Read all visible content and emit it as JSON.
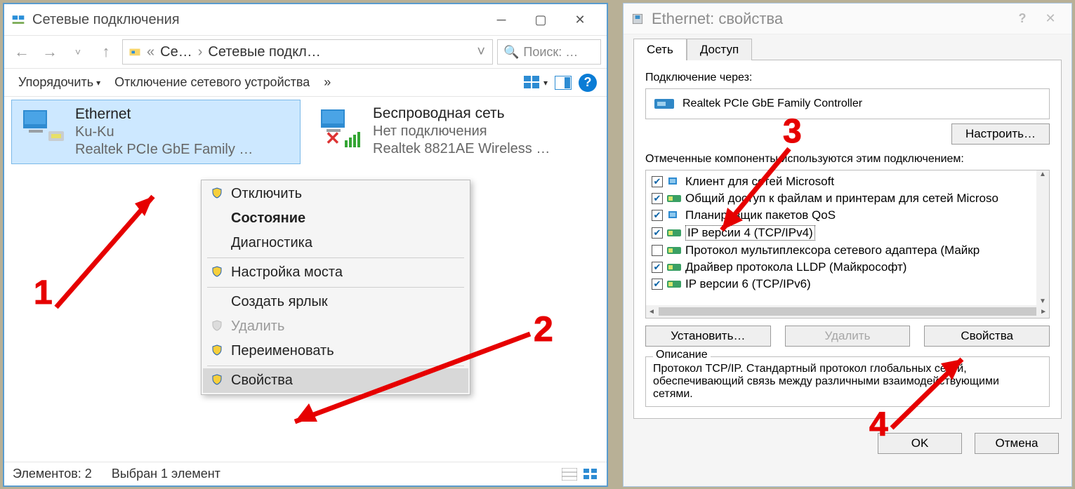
{
  "win1": {
    "title": "Сетевые подключения",
    "breadcrumb": {
      "seg1": "Се…",
      "seg2": "Сетевые подкл…"
    },
    "search_placeholder": "Поиск: …",
    "toolbar": {
      "organize": "Упорядочить",
      "disable": "Отключение сетевого устройства",
      "more": "»"
    },
    "connections": {
      "eth": {
        "name": "Ethernet",
        "sub1": "Ku-Ku",
        "sub2": "Realtek PCIe GbE Family …"
      },
      "wifi": {
        "name": "Беспроводная сеть",
        "sub1": "Нет подключения",
        "sub2": "Realtek 8821AE Wireless …"
      }
    },
    "ctx": {
      "disable": "Отключить",
      "status": "Состояние",
      "diagnose": "Диагностика",
      "bridge": "Настройка моста",
      "shortcut": "Создать ярлык",
      "delete": "Удалить",
      "rename": "Переименовать",
      "properties": "Свойства"
    },
    "status": {
      "elements": "Элементов: 2",
      "selected": "Выбран 1 элемент"
    }
  },
  "win2": {
    "title": "Ethernet: свойства",
    "tabs": {
      "net": "Сеть",
      "access": "Доступ"
    },
    "connect_via_label": "Подключение через:",
    "adapter": "Realtek PCIe GbE Family Controller",
    "configure": "Настроить…",
    "components_label": "Отмеченные компоненты используются этим подключением:",
    "components": [
      {
        "checked": true,
        "text": "Клиент для сетей Microsoft"
      },
      {
        "checked": true,
        "text": "Общий доступ к файлам и принтерам для сетей Microso"
      },
      {
        "checked": true,
        "text": "Планировщик пакетов QoS"
      },
      {
        "checked": true,
        "text": "IP версии 4 (TCP/IPv4)",
        "selected": true
      },
      {
        "checked": false,
        "text": "Протокол мультиплексора сетевого адаптера (Майкр"
      },
      {
        "checked": true,
        "text": "Драйвер протокола LLDP (Майкрософт)"
      },
      {
        "checked": true,
        "text": "IP версии 6 (TCP/IPv6)"
      }
    ],
    "install": "Установить…",
    "remove": "Удалить",
    "properties": "Свойства",
    "desc_legend": "Описание",
    "desc_text": "Протокол TCP/IP. Стандартный протокол глобальных сетей, обеспечивающий связь между различными взаимодействующими сетями.",
    "ok": "OK",
    "cancel": "Отмена"
  },
  "steps": {
    "s1": "1",
    "s2": "2",
    "s3": "3",
    "s4": "4"
  }
}
